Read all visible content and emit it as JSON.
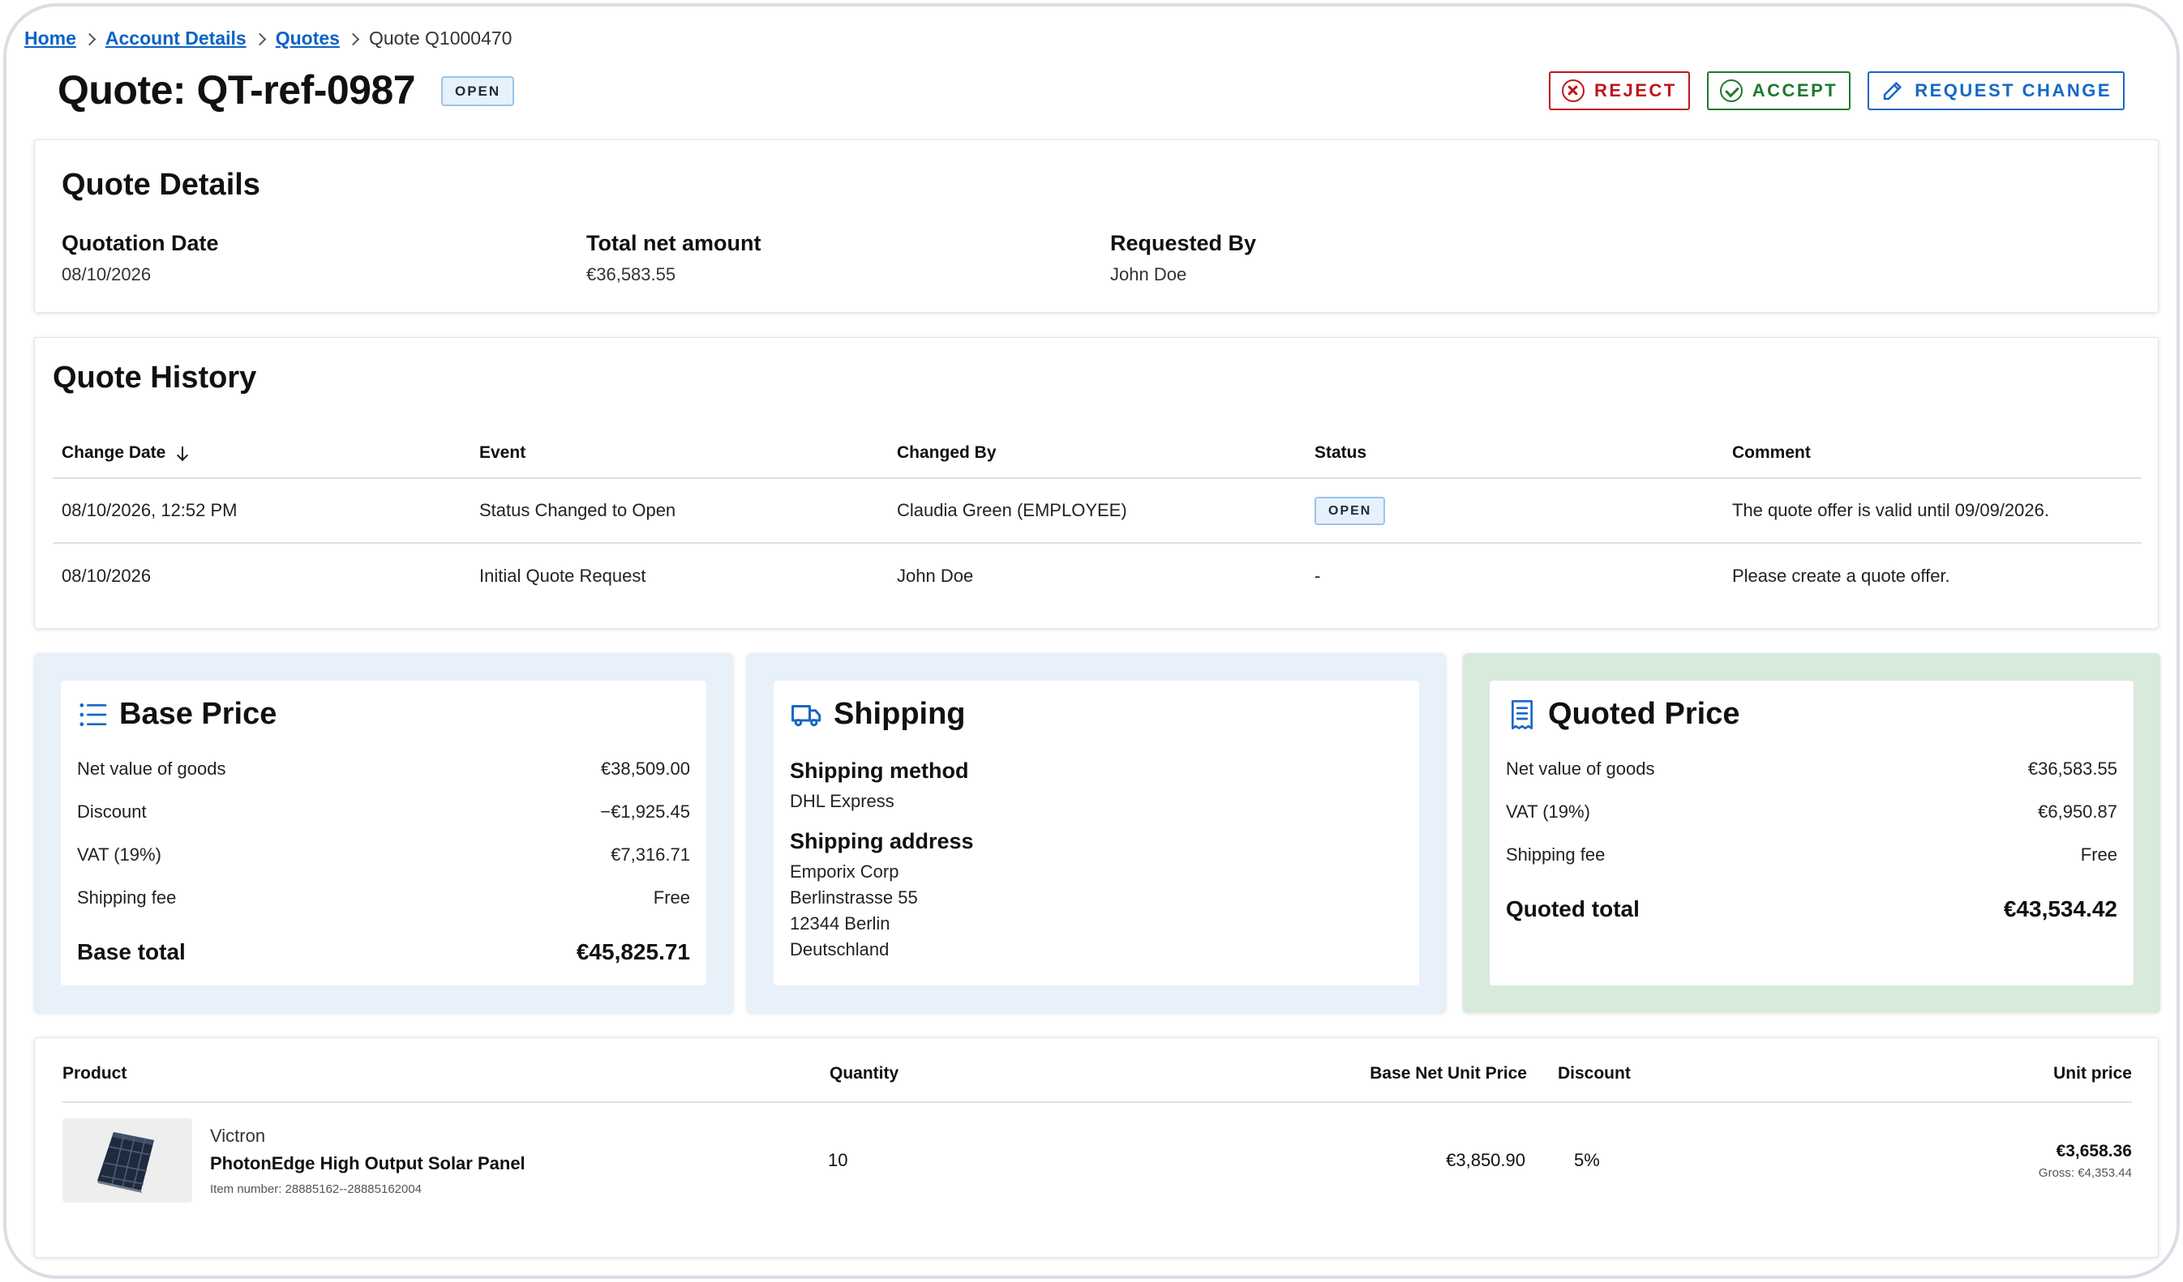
{
  "breadcrumb": {
    "home": "Home",
    "account": "Account Details",
    "quotes": "Quotes",
    "current": "Quote Q1000470"
  },
  "header": {
    "title": "Quote: QT-ref-0987",
    "status_badge": "OPEN",
    "reject_label": "REJECT",
    "accept_label": "ACCEPT",
    "request_change_label": "REQUEST CHANGE"
  },
  "details": {
    "title": "Quote Details",
    "quotation_date_label": "Quotation Date",
    "quotation_date": "08/10/2026",
    "total_net_label": "Total net amount",
    "total_net": "€36,583.55",
    "requested_by_label": "Requested By",
    "requested_by": "John Doe"
  },
  "history": {
    "title": "Quote History",
    "columns": [
      "Change Date",
      "Event",
      "Changed By",
      "Status",
      "Comment"
    ],
    "rows": [
      {
        "date": "08/10/2026, 12:52 PM",
        "event": "Status Changed to Open",
        "changed_by": "Claudia Green (EMPLOYEE)",
        "status": "OPEN",
        "comment": "The quote offer is valid until 09/09/2026."
      },
      {
        "date": "08/10/2026",
        "event": "Initial Quote Request",
        "changed_by": "John Doe",
        "status": "-",
        "comment": "Please create a quote offer."
      }
    ]
  },
  "base_price": {
    "title": "Base Price",
    "icon": "list-icon",
    "rows": [
      {
        "label": "Net value of goods",
        "value": "€38,509.00"
      },
      {
        "label": "Discount",
        "value": "−€1,925.45"
      },
      {
        "label": "VAT (19%)",
        "value": "€7,316.71"
      },
      {
        "label": "Shipping fee",
        "value": "Free"
      }
    ],
    "total_label": "Base total",
    "total_value": "€45,825.71"
  },
  "shipping": {
    "title": "Shipping",
    "icon": "truck-icon",
    "method_label": "Shipping method",
    "method": "DHL Express",
    "address_label": "Shipping address",
    "address_lines": [
      "Emporix Corp",
      "Berlinstrasse 55",
      "12344 Berlin",
      "Deutschland"
    ]
  },
  "quoted_price": {
    "title": "Quoted Price",
    "icon": "receipt-icon",
    "rows": [
      {
        "label": "Net value of goods",
        "value": "€36,583.55"
      },
      {
        "label": "VAT (19%)",
        "value": "€6,950.87"
      },
      {
        "label": "Shipping fee",
        "value": "Free"
      }
    ],
    "total_label": "Quoted total",
    "total_value": "€43,534.42"
  },
  "products": {
    "columns": {
      "product": "Product",
      "quantity": "Quantity",
      "base_net_unit_price": "Base Net Unit Price",
      "discount": "Discount",
      "unit_price": "Unit price"
    },
    "items": [
      {
        "brand": "Victron",
        "name": "PhotonEdge High Output Solar Panel",
        "item_number": "Item number: 28885162--28885162004",
        "quantity": "10",
        "base_net_unit_price": "€3,850.90",
        "discount": "5%",
        "unit_price": "€3,658.36",
        "gross": "Gross: €4,353.44"
      }
    ]
  },
  "colors": {
    "link": "#0b63c4",
    "reject": "#c0161b",
    "accept": "#1d7a2d",
    "request_change": "#1668c5",
    "panel_blue": "#e8f0fa",
    "panel_green": "#d7eadb",
    "badge_bg": "#e6f1fb"
  }
}
